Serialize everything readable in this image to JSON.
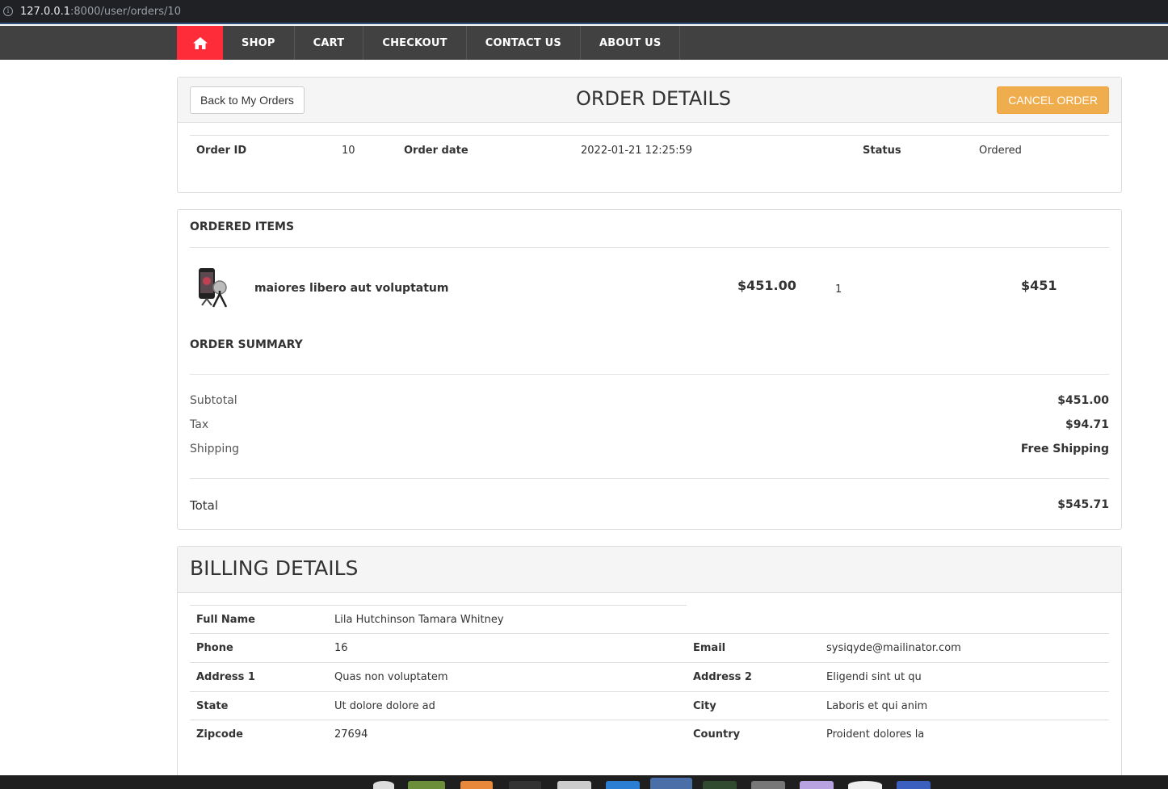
{
  "browser": {
    "url_host": "127.0.0.1",
    "url_path": ":8000/user/orders/10"
  },
  "nav": {
    "home_icon": "home-icon",
    "items": [
      "SHOP",
      "CART",
      "CHECKOUT",
      "CONTACT US",
      "ABOUT US"
    ],
    "accent_color": "#fe2b39"
  },
  "order": {
    "back_label": "Back to My Orders",
    "title": "ORDER DETAILS",
    "cancel_label": "CANCEL ORDER",
    "id_label": "Order ID",
    "id_value": "10",
    "date_label": "Order date",
    "date_value": "2022-01-21 12:25:59",
    "status_label": "Status",
    "status_value": "Ordered"
  },
  "items_section": {
    "title": "ORDERED ITEMS",
    "items": [
      {
        "name": "maiores libero aut voluptatum",
        "price": "$451.00",
        "qty": "1",
        "total": "$451"
      }
    ]
  },
  "summary": {
    "title": "ORDER SUMMARY",
    "subtotal_label": "Subtotal",
    "subtotal_value": "$451.00",
    "tax_label": "Tax",
    "tax_value": "$94.71",
    "shipping_label": "Shipping",
    "shipping_value": "Free Shipping",
    "total_label": "Total",
    "total_value": "$545.71"
  },
  "billing": {
    "title": "BILLING DETAILS",
    "full_name_label": "Full Name",
    "full_name": "Lila Hutchinson Tamara Whitney",
    "phone_label": "Phone",
    "phone": "16",
    "email_label": "Email",
    "email": "sysiqyde@mailinator.com",
    "address1_label": "Address 1",
    "address1": "Quas non voluptatem",
    "address2_label": "Address 2",
    "address2": "Eligendi sint ut qu",
    "state_label": "State",
    "state": "Ut dolore dolore ad",
    "city_label": "City",
    "city": "Laboris et qui anim",
    "zipcode_label": "Zipcode",
    "zipcode": "27694",
    "country_label": "Country",
    "country": "Proident dolores la"
  }
}
